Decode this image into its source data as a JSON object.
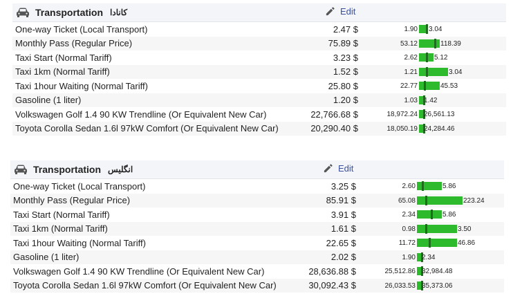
{
  "sections": [
    {
      "title": "Transportation",
      "country": "کانادا",
      "edit_label": "Edit",
      "rows": [
        {
          "name": "One-way Ticket (Local Transport)",
          "price": "2.47 $",
          "min": "1.90",
          "max": "3.04",
          "bar_fraction": 0.13,
          "marker_fraction": 0.1
        },
        {
          "name": "Monthly Pass (Regular Price)",
          "price": "75.89 $",
          "min": "53.12",
          "max": "118.39",
          "bar_fraction": 0.3,
          "marker_fraction": 0.22
        },
        {
          "name": "Taxi Start (Normal Tariff)",
          "price": "3.23 $",
          "min": "2.62",
          "max": "5.12",
          "bar_fraction": 0.21,
          "marker_fraction": 0.1
        },
        {
          "name": "Taxi 1km (Normal Tariff)",
          "price": "1.52 $",
          "min": "1.21",
          "max": "3.04",
          "bar_fraction": 0.42,
          "marker_fraction": 0.1
        },
        {
          "name": "Taxi 1hour Waiting (Normal Tariff)",
          "price": "25.80 $",
          "min": "22.77",
          "max": "45.53",
          "bar_fraction": 0.3,
          "marker_fraction": 0.07
        },
        {
          "name": "Gasoline (1 liter)",
          "price": "1.20 $",
          "min": "1.03",
          "max": "1.42",
          "bar_fraction": 0.06,
          "marker_fraction": 0.06
        },
        {
          "name": "Volkswagen Golf 1.4 90 KW Trendline (Or Equivalent New Car)",
          "price": "22,766.68 $",
          "min": "18,972.24",
          "max": "26,561.13",
          "bar_fraction": 0.06,
          "marker_fraction": 0.06
        },
        {
          "name": "Toyota Corolla Sedan 1.6l 97kW Comfort (Or Equivalent New Car)",
          "price": "20,290.40 $",
          "min": "18,050.19",
          "max": "24,284.46",
          "bar_fraction": 0.06,
          "marker_fraction": 0.06
        }
      ]
    },
    {
      "title": "Transportation",
      "country": "انگلیس",
      "edit_label": "Edit",
      "rows": [
        {
          "name": "One-way Ticket (Local Transport)",
          "price": "3.25 $",
          "min": "2.60",
          "max": "5.86",
          "bar_fraction": 0.36,
          "marker_fraction": 0.07
        },
        {
          "name": "Monthly Pass (Regular Price)",
          "price": "85.91 $",
          "min": "65.08",
          "max": "223.24",
          "bar_fraction": 0.66,
          "marker_fraction": 0.12
        },
        {
          "name": "Taxi Start (Normal Tariff)",
          "price": "3.91 $",
          "min": "2.34",
          "max": "5.86",
          "bar_fraction": 0.36,
          "marker_fraction": 0.2
        },
        {
          "name": "Taxi 1km (Normal Tariff)",
          "price": "1.61 $",
          "min": "0.98",
          "max": "3.50",
          "bar_fraction": 0.58,
          "marker_fraction": 0.12
        },
        {
          "name": "Taxi 1hour Waiting (Normal Tariff)",
          "price": "22.65 $",
          "min": "11.72",
          "max": "46.86",
          "bar_fraction": 0.58,
          "marker_fraction": 0.17
        },
        {
          "name": "Gasoline (1 liter)",
          "price": "2.02 $",
          "min": "1.90",
          "max": "2.34",
          "bar_fraction": 0.06,
          "marker_fraction": 0.06
        },
        {
          "name": "Volkswagen Golf 1.4 90 KW Trendline (Or Equivalent New Car)",
          "price": "28,636.88 $",
          "min": "25,512.86",
          "max": "32,984.48",
          "bar_fraction": 0.06,
          "marker_fraction": 0.06
        },
        {
          "name": "Toyota Corolla Sedan 1.6l 97kW Comfort (Or Equivalent New Car)",
          "price": "30,092.43 $",
          "min": "26,033.53",
          "max": "35,373.06",
          "bar_fraction": 0.06,
          "marker_fraction": 0.06
        }
      ]
    }
  ],
  "colors": {
    "bar": "#2dbb2d",
    "marker": "#1e6b1e",
    "link": "#3a4e9c",
    "header_bg": "#f4f5f9"
  },
  "icons": {
    "section": "car-icon",
    "edit": "pencil-icon"
  }
}
